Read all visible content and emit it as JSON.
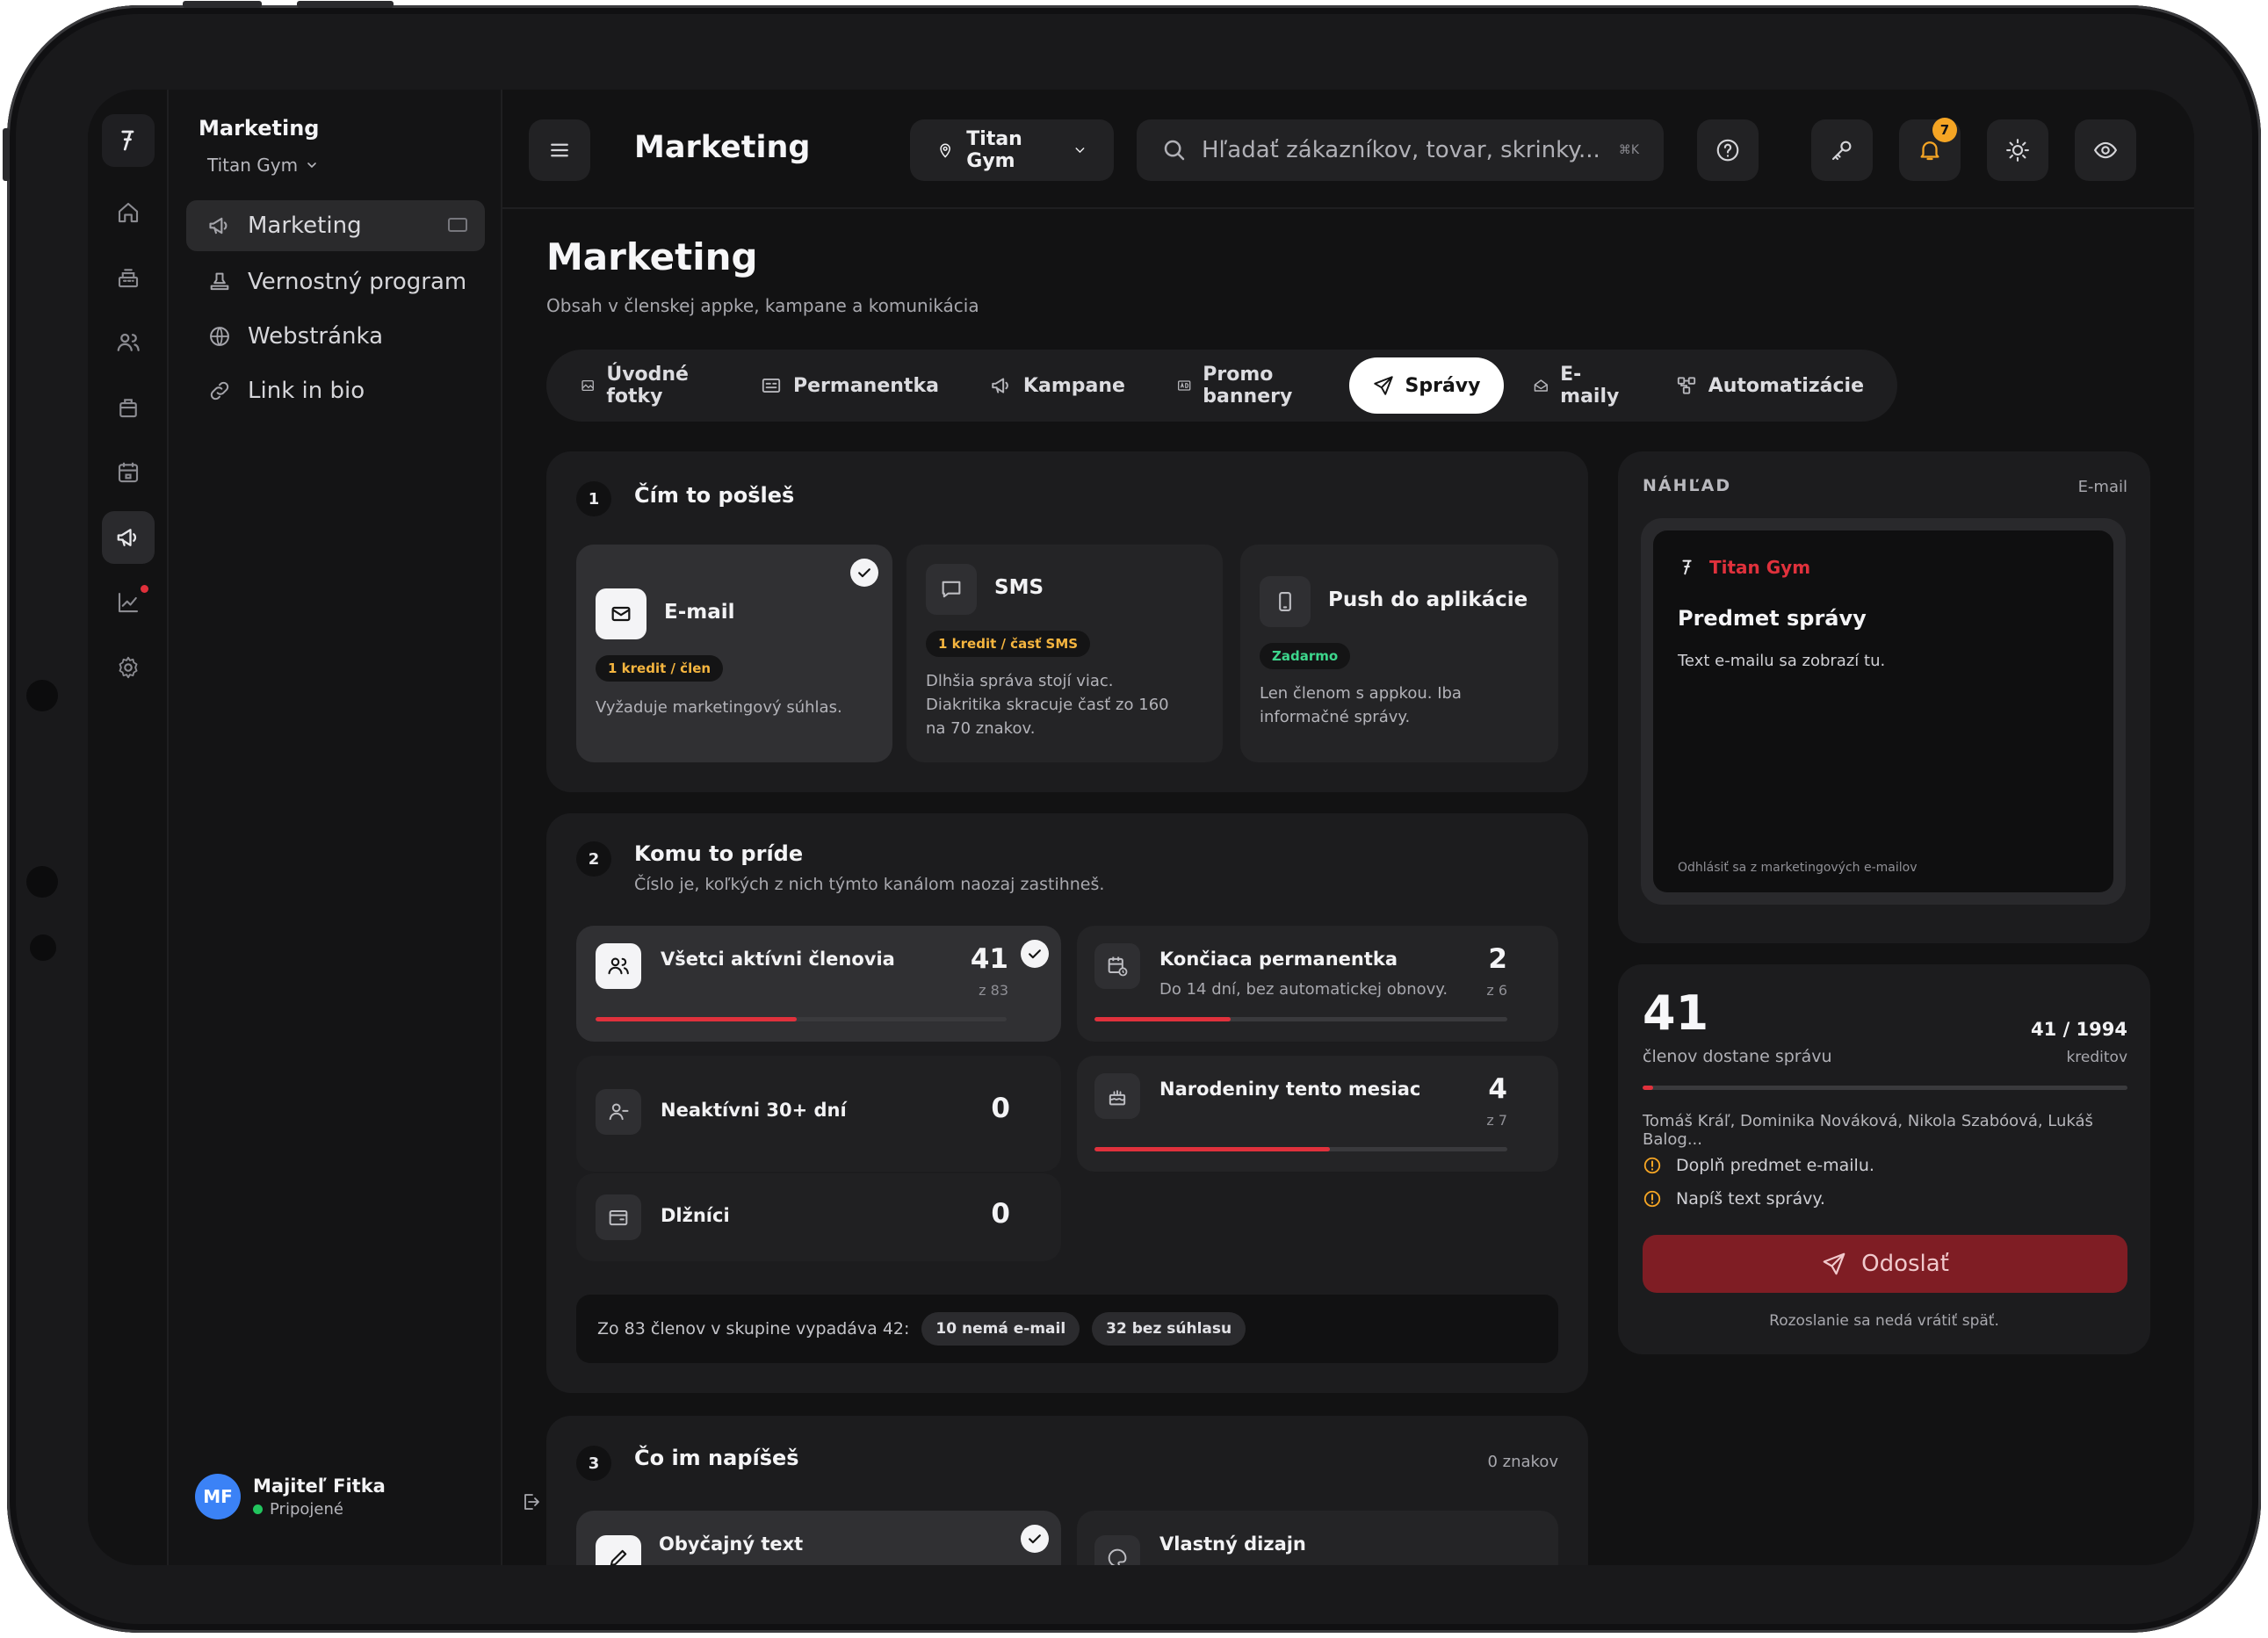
{
  "sidebar": {
    "title": "Marketing",
    "org": "Titan Gym",
    "items": [
      {
        "label": "Marketing"
      },
      {
        "label": "Vernostný program"
      },
      {
        "label": "Webstránka"
      },
      {
        "label": "Link in bio"
      }
    ],
    "user": {
      "initials": "MF",
      "name": "Majiteľ Fitka",
      "status": "Pripojené"
    }
  },
  "topbar": {
    "title": "Marketing",
    "location": "Titan Gym",
    "search_placeholder": "Hľadať zákazníkov, tovar, skrinky...",
    "search_shortcut": "⌘K",
    "notifications_count": "7"
  },
  "page": {
    "title": "Marketing",
    "subtitle": "Obsah v členskej appke, kampane a komunikácia"
  },
  "tabs": [
    {
      "label": "Úvodné fotky"
    },
    {
      "label": "Permanentka"
    },
    {
      "label": "Kampane"
    },
    {
      "label": "Promo bannery"
    },
    {
      "label": "Správy"
    },
    {
      "label": "E-maily"
    },
    {
      "label": "Automatizácie"
    }
  ],
  "step1": {
    "num": "1",
    "title": "Čím to pošleš",
    "channels": [
      {
        "title": "E-mail",
        "pill": "1 kredit / člen",
        "text": "Vyžaduje marketingový súhlas."
      },
      {
        "title": "SMS",
        "pill": "1 kredit / časť SMS",
        "text": "Dlhšia správa stojí viac. Diakritika skracuje časť zo 160 na 70 znakov."
      },
      {
        "title": "Push do aplikácie",
        "pill": "Zadarmo",
        "text": "Len členom s appkou. Iba informačné správy."
      }
    ]
  },
  "step2": {
    "num": "2",
    "title": "Komu to príde",
    "subtitle": "Číslo je, koľkých z nich týmto kanálom naozaj zastihneš.",
    "audiences": [
      {
        "title": "Všetci aktívni členovia",
        "subtitle": "",
        "count": "41",
        "of": "z 83",
        "progress": 0.49
      },
      {
        "title": "Končiaca permanentka",
        "subtitle": "Do 14 dní, bez automatickej obnovy.",
        "count": "2",
        "of": "z 6",
        "progress": 0.33
      },
      {
        "title": "Neaktívni 30+ dní",
        "subtitle": "",
        "count": "0",
        "of": "",
        "progress": 0
      },
      {
        "title": "Narodeniny tento mesiac",
        "subtitle": "",
        "count": "4",
        "of": "z 7",
        "progress": 0.57
      },
      {
        "title": "Dlžníci",
        "subtitle": "",
        "count": "0",
        "of": "",
        "progress": 0
      }
    ],
    "exclusion_text": "Zo 83 členov v skupine vypadáva 42:",
    "exclusion_chips": [
      "10 nemá e-mail",
      "32 bez súhlasu"
    ]
  },
  "step3": {
    "num": "3",
    "title": "Čo im napíšeš",
    "counter": "0 znakov",
    "options": [
      {
        "title": "Obyčajný text"
      },
      {
        "title": "Vlastný dizajn"
      }
    ]
  },
  "preview": {
    "label": "NÁHĽAD",
    "kind": "E-mail",
    "brand": "Titan Gym",
    "subject": "Predmet správy",
    "body": "Text e-mailu sa zobrazí tu.",
    "unsubscribe": "Odhlásiť sa z marketingových e-mailov"
  },
  "summary": {
    "recipients": "41",
    "recipients_label": "členov dostane správu",
    "credits": "41 / 1994",
    "credits_label": "kreditov",
    "credit_progress": 0.02,
    "names": "Tomáš Kráľ, Dominika Nováková, Nikola Szabóová, Lukáš Balog...",
    "warnings": [
      "Doplň predmet e-mailu.",
      "Napíš text správy."
    ],
    "send_label": "Odoslať",
    "send_note": "Rozoslanie sa nedá vrátiť späť."
  },
  "colors": {
    "accent": "#e0313c",
    "send_button": "#7f1d24",
    "warning": "#f5a524",
    "online": "#22c55e",
    "avatar": "#3b82f6"
  }
}
